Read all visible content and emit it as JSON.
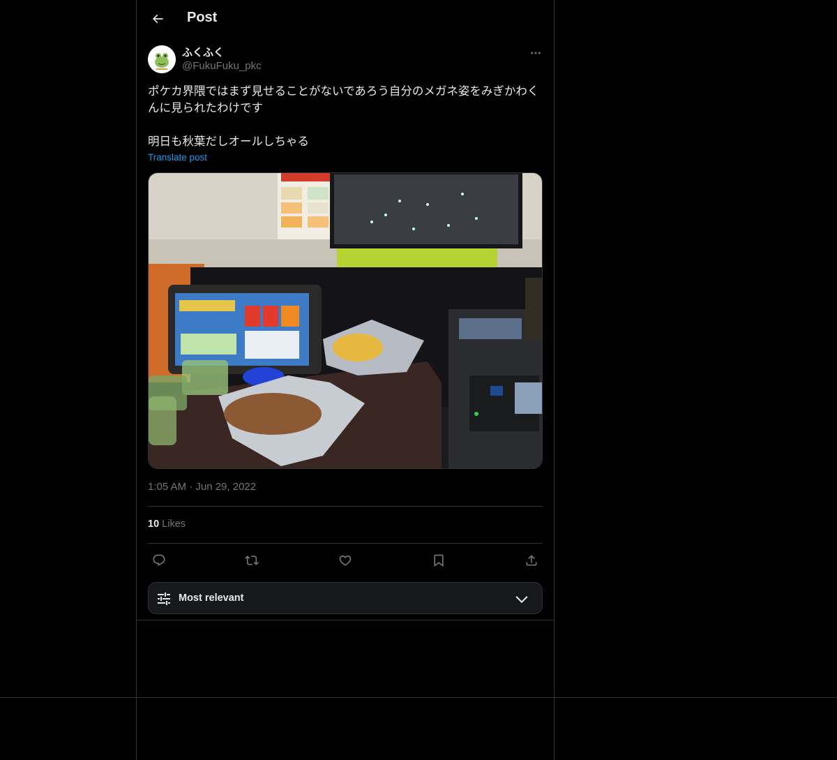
{
  "header": {
    "title": "Post"
  },
  "author": {
    "name": "ふくふく",
    "handle": "@FukuFuku_pkc"
  },
  "post": {
    "line1": "ポケカ界隈ではまず見せることがないであろう自分のメガネ姿をみぎかわくんに見られたわけです",
    "line2": "明日も秋葉だしオールしちゃる",
    "translate_label": "Translate post",
    "timestamp": "1:05 AM · Jun 29, 2022"
  },
  "stats": {
    "likes_count": "10",
    "likes_label": " Likes"
  },
  "sort": {
    "label": "Most relevant"
  },
  "colors": {
    "accent": "#1d9bf0",
    "bg": "#000000",
    "border": "#2f3336",
    "muted": "#71767b"
  }
}
